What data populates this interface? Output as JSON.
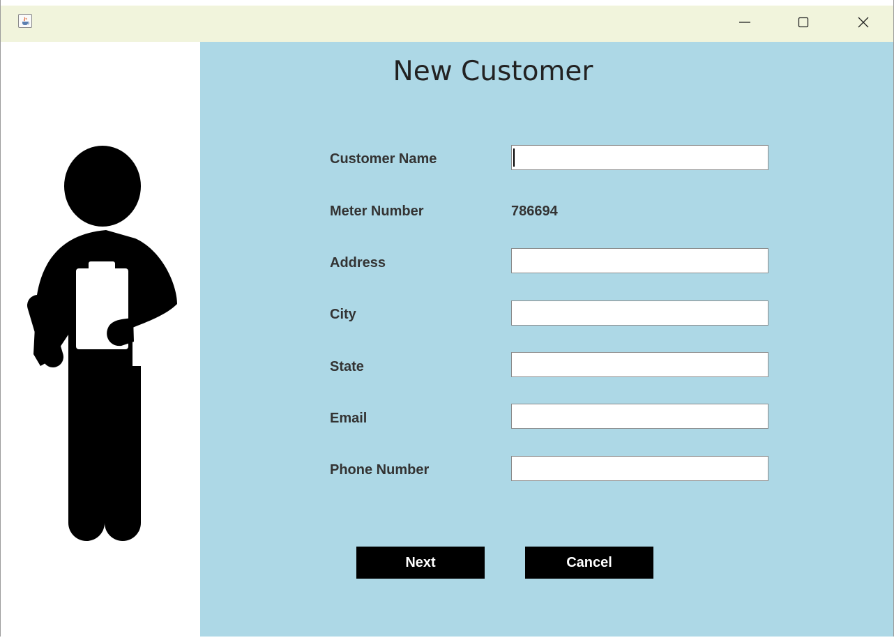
{
  "window": {
    "icon": "java-icon",
    "controls": [
      "minimize-icon",
      "maximize-icon",
      "close-icon"
    ]
  },
  "illustration": {
    "icon": "person-with-clipboard-icon"
  },
  "form": {
    "title": "New Customer",
    "fields": {
      "customer_name": {
        "label": "Customer Name",
        "value": ""
      },
      "meter_number": {
        "label": "Meter Number",
        "value": "786694"
      },
      "address": {
        "label": "Address",
        "value": ""
      },
      "city": {
        "label": "City",
        "value": ""
      },
      "state": {
        "label": "State",
        "value": ""
      },
      "email": {
        "label": "Email",
        "value": ""
      },
      "phone_number": {
        "label": "Phone Number",
        "value": ""
      }
    },
    "buttons": {
      "next": "Next",
      "cancel": "Cancel"
    }
  },
  "colors": {
    "form_background": "#add8e6",
    "titlebar": "#f1f4dc",
    "button_background": "#000000",
    "button_text": "#ffffff"
  }
}
